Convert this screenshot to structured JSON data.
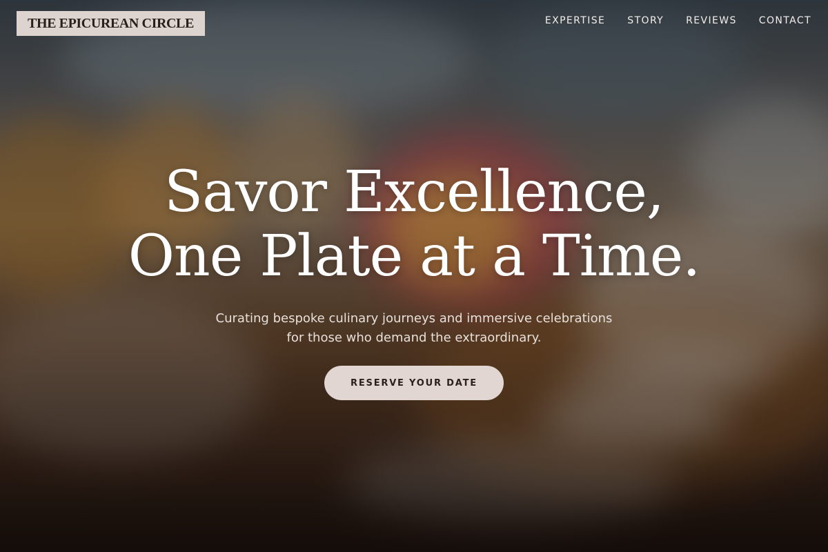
{
  "header": {
    "logo_text": "THE EPICUREAN CIRCLE",
    "nav": [
      {
        "label": "EXPERTISE"
      },
      {
        "label": "STORY"
      },
      {
        "label": "REVIEWS"
      },
      {
        "label": "CONTACT"
      }
    ]
  },
  "hero": {
    "headline_line1": "Savor Excellence,",
    "headline_line2": "One Plate at a Time.",
    "subhead_line1": "Curating bespoke culinary journeys and immersive celebrations",
    "subhead_line2": "for those who demand the extraordinary.",
    "cta_label": "RESERVE YOUR DATE"
  },
  "colors": {
    "logo_bg": "#ddd3cf",
    "cta_bg": "#e2d6d2",
    "text_dark": "#2b1f1c",
    "text_light": "#ffffff"
  }
}
